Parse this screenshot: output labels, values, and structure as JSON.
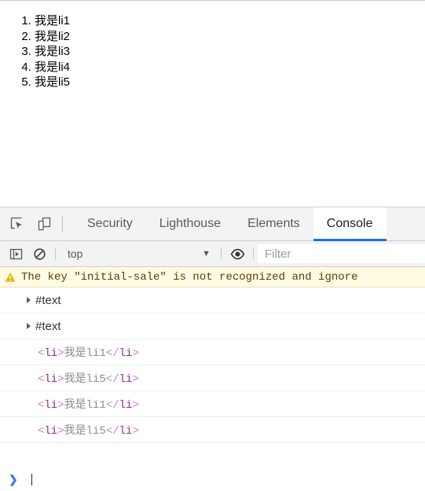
{
  "page": {
    "list_items": [
      "我是li1",
      "我是li2",
      "我是li3",
      "我是li4",
      "我是li5"
    ]
  },
  "devtools": {
    "left_buttons": [
      {
        "name": "inspect-element-icon",
        "title": "Inspect element"
      },
      {
        "name": "device-toolbar-icon",
        "title": "Toggle device toolbar"
      }
    ],
    "tabs": [
      {
        "label": "Security",
        "active": false
      },
      {
        "label": "Lighthouse",
        "active": false
      },
      {
        "label": "Elements",
        "active": false
      },
      {
        "label": "Console",
        "active": true
      }
    ],
    "accent_color": "#1a73e8"
  },
  "console_toolbar": {
    "sidebar_toggle": "console-sidebar-icon",
    "clear_console": "clear-console-icon",
    "context": "top",
    "context_caret": "▼",
    "eye_button": "live-expression-eye-icon",
    "filter_placeholder": "Filter"
  },
  "console": {
    "warning": {
      "icon": "warning-triangle-icon",
      "text": "The key \"initial-sale\" is not recognized and ignore",
      "bg_color": "#fffbe5",
      "text_color": "#5c3c00"
    },
    "messages": [
      {
        "type": "node",
        "label": "#text",
        "expandable": true
      },
      {
        "type": "node",
        "label": "#text",
        "expandable": true
      },
      {
        "type": "html",
        "open_lt": "<",
        "tag": "li",
        "open_gt": ">",
        "content": "我是li1",
        "close_lt": "</",
        "close_gt": ">"
      },
      {
        "type": "html",
        "open_lt": "<",
        "tag": "li",
        "open_gt": ">",
        "content": "我是li5",
        "close_lt": "</",
        "close_gt": ">"
      },
      {
        "type": "html",
        "open_lt": "<",
        "tag": "li",
        "open_gt": ">",
        "content": "我是li1",
        "close_lt": "</",
        "close_gt": ">"
      },
      {
        "type": "html",
        "open_lt": "<",
        "tag": "li",
        "open_gt": ">",
        "content": "我是li5",
        "close_lt": "</",
        "close_gt": ">"
      }
    ],
    "prompt_chevron": "❯",
    "prompt_value": ""
  }
}
